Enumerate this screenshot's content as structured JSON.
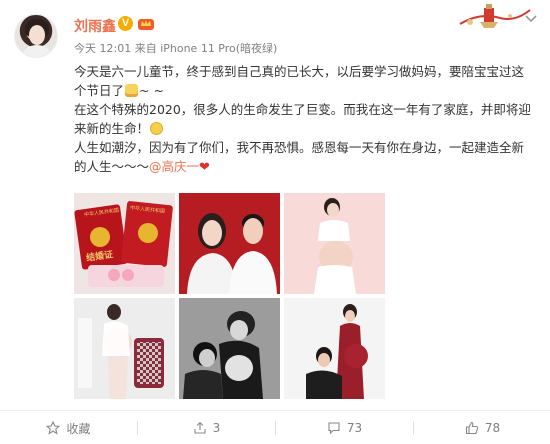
{
  "user": {
    "name": "刘雨鑫",
    "verified_badge": "V",
    "meta": "今天 12:01 来自 iPhone 11 Pro(暗夜绿)"
  },
  "post": {
    "p1": "今天是六一儿童节，终于感到自己真的已长大，以后要学习做妈妈，要陪宝宝过这个节日了",
    "p1_tail": "~ ~",
    "p2": "在这个特殊的2020，很多人的生命发生了巨变。而我在这一年有了家庭，并即将迎来新的生命！",
    "p3": "人生如潮汐，因为有了你们，我不再恐惧。感恩每一天有你在身边，一起建造全新的人生～～～",
    "mention": "@高庆一",
    "heart": "❤"
  },
  "photos": {
    "cert_label_left": "中华人民共和国",
    "cert_label_right": "中华人民共和国",
    "cert_title": "结婚证"
  },
  "footer": {
    "favorite": "收藏",
    "repost": "3",
    "comment": "73",
    "like": "78"
  },
  "colors": {
    "accent": "#eb7350",
    "badge": "#f6ab00"
  },
  "icons": [
    "star-icon",
    "share-icon",
    "comment-icon",
    "like-icon",
    "chevron-down-icon"
  ]
}
